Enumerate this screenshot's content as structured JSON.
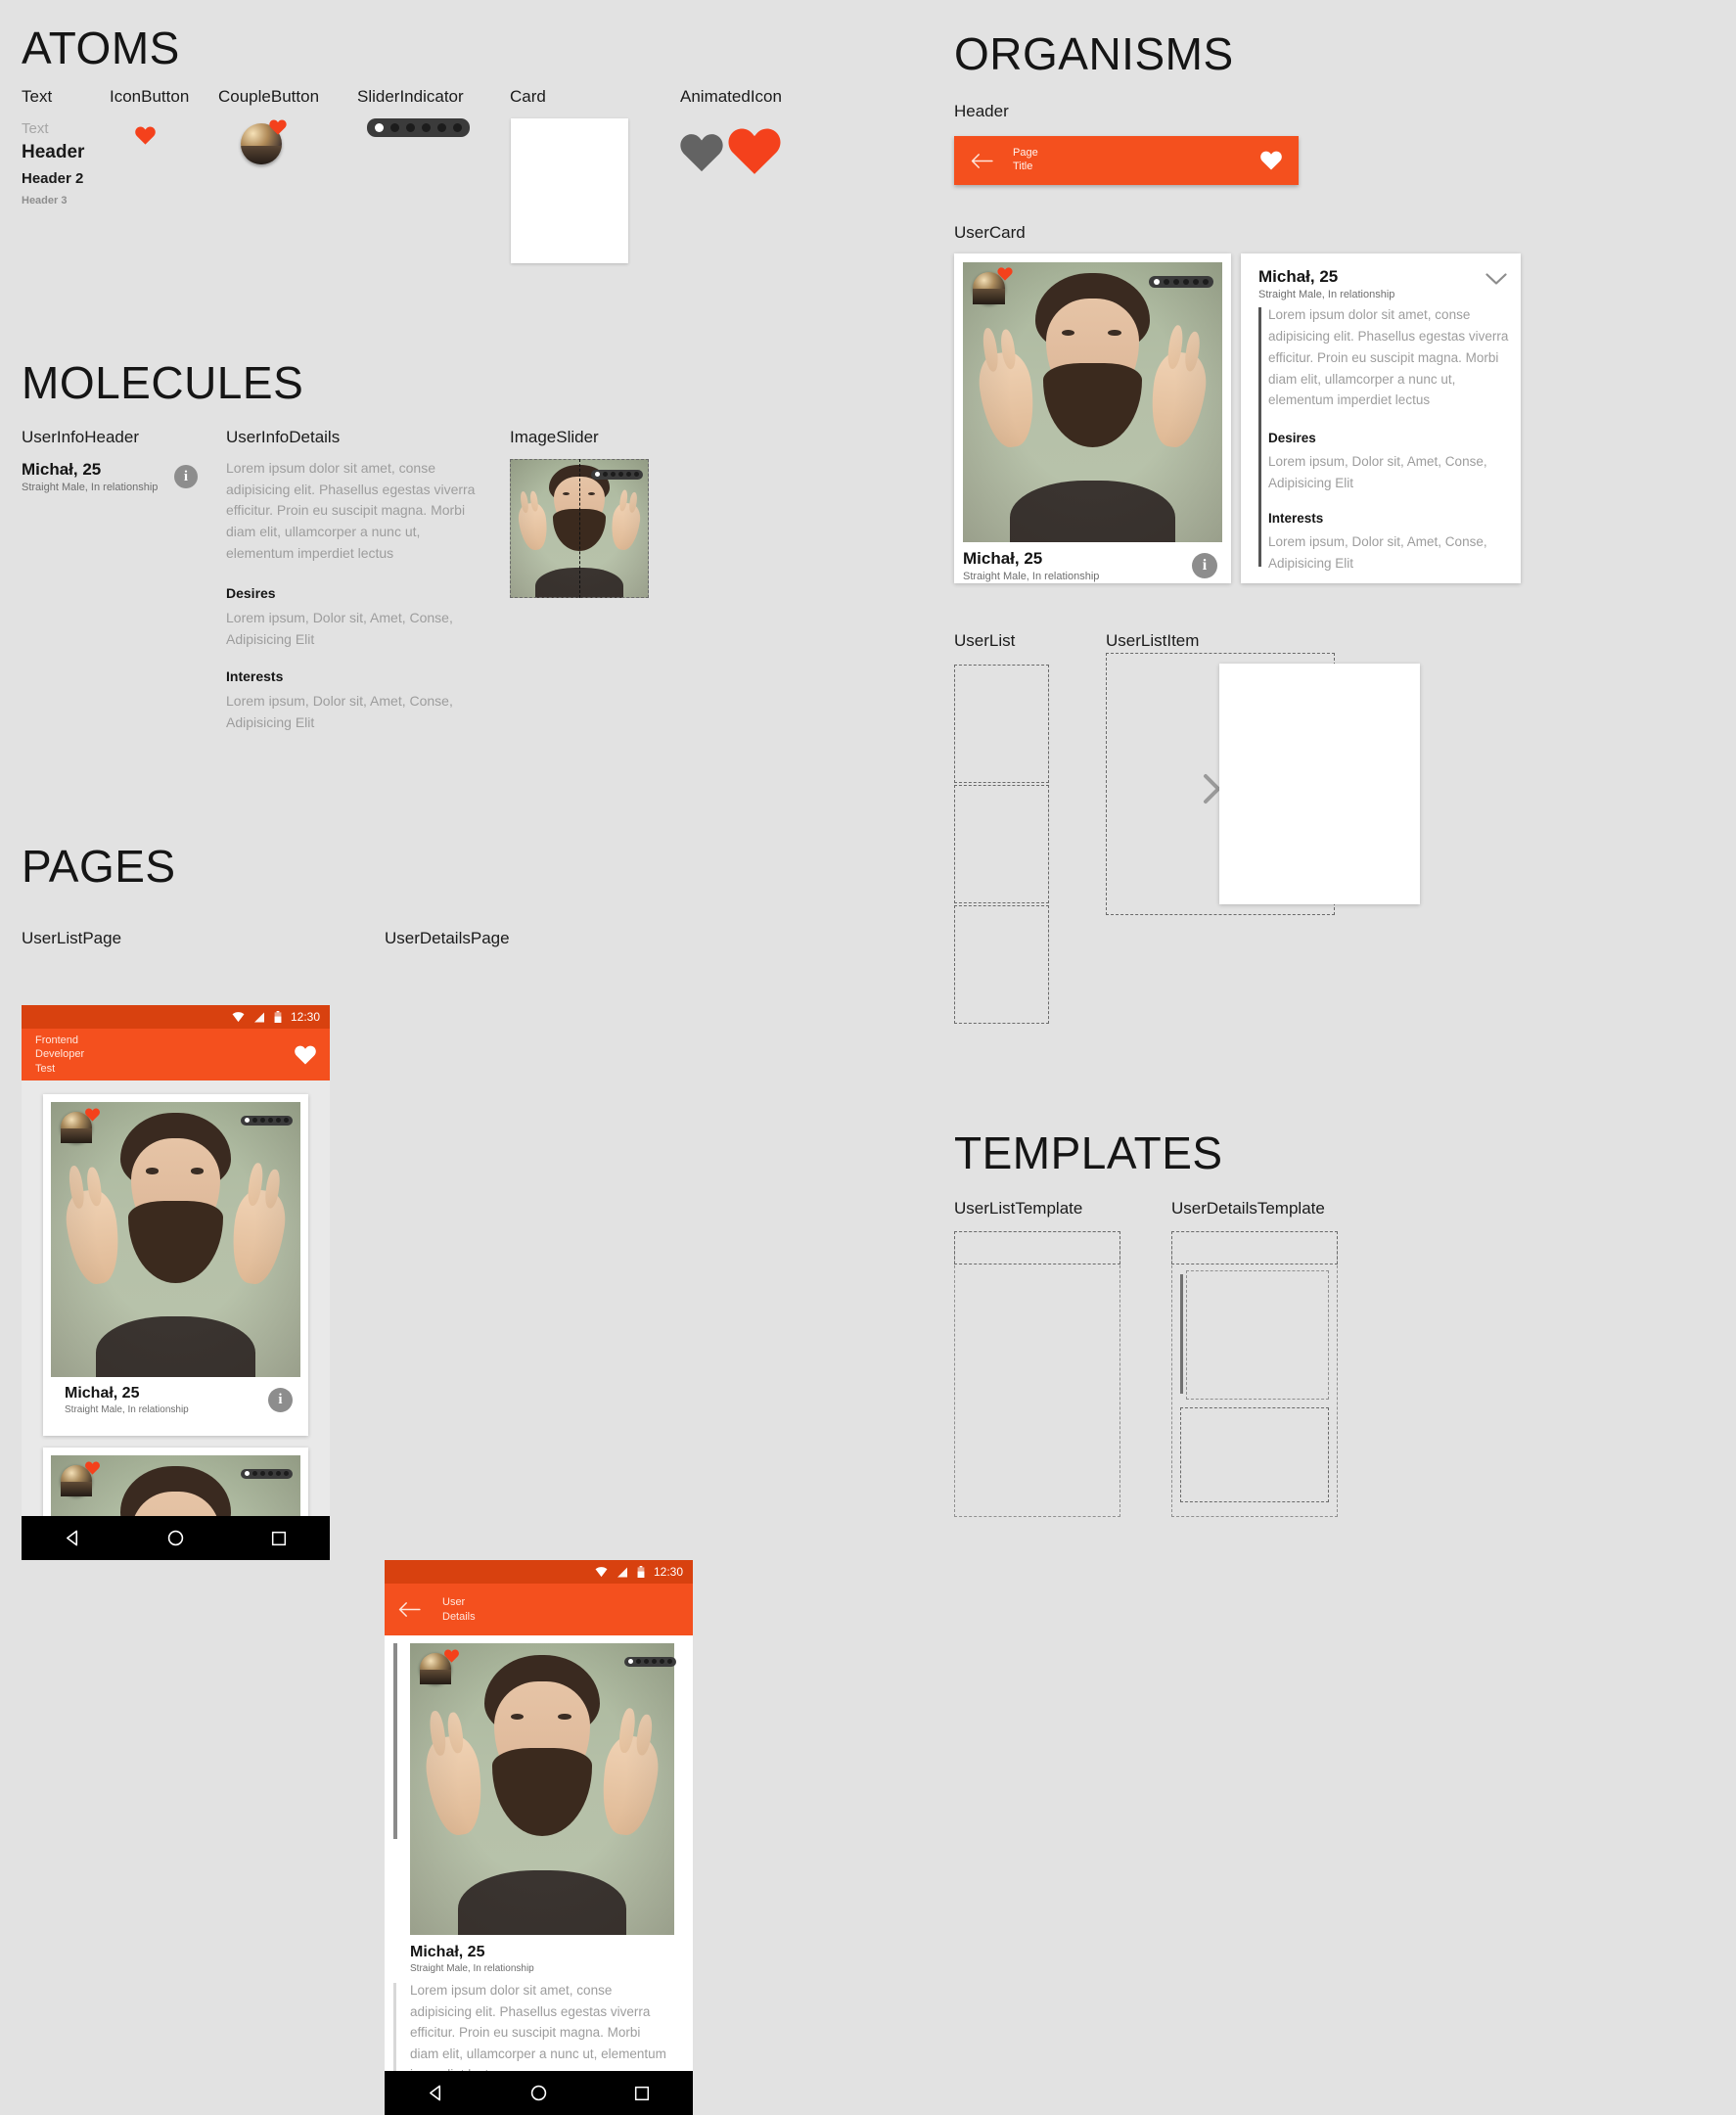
{
  "meta": {
    "bg_color": "#e2e2e2",
    "accent": "#f4501e",
    "accent_dark": "#d8410f",
    "heart_red": "#f4411c",
    "heart_gray": "#616161",
    "muted_text": "#9d9d9d"
  },
  "sections": {
    "atoms": "ATOMS",
    "molecules": "MOLECULES",
    "pages": "PAGES",
    "organisms": "ORGANISMS",
    "templates": "TEMPLATES"
  },
  "atoms": {
    "labels": {
      "text": "Text",
      "icon_button": "IconButton",
      "couple_button": "CoupleButton",
      "slider_indicator": "SliderIndicator",
      "card": "Card",
      "animated_icon": "AnimatedIcon"
    },
    "text_samples": {
      "body": "Text",
      "header": "Header",
      "header2": "Header 2",
      "header3": "Header 3"
    },
    "slider": {
      "total": 6,
      "active_index": 0
    }
  },
  "molecules": {
    "labels": {
      "user_info_header": "UserInfoHeader",
      "user_info_details": "UserInfoDetails",
      "image_slider": "ImageSlider"
    },
    "user": {
      "name": "Michał, 25",
      "subtitle": "Straight Male, In relationship",
      "info_icon_glyph": "i"
    },
    "details": {
      "bio": "Lorem ipsum dolor sit amet, conse adipisicing elit. Phasellus egestas viverra efficitur. Proin eu suscipit magna. Morbi diam elit, ullamcorper a nunc ut, elementum imperdiet lectus",
      "desires_label": "Desires",
      "desires_value": "Lorem ipsum, Dolor sit, Amet, Conse, Adipisicing Elit",
      "interests_label": "Interests",
      "interests_value": "Lorem ipsum, Dolor sit, Amet, Conse, Adipisicing Elit"
    }
  },
  "organisms": {
    "labels": {
      "header": "Header",
      "user_card": "UserCard",
      "user_list": "UserList",
      "user_list_item": "UserListItem"
    },
    "header_bar": {
      "title_line1": "Page",
      "title_line2": "Title",
      "back_icon": "arrow-left-icon",
      "action_icon": "heart-icon"
    },
    "user_card": {
      "name": "Michał, 25",
      "subtitle": "Straight Male, In relationship",
      "bio": "Lorem ipsum dolor sit amet, conse adipisicing elit. Phasellus egestas viverra efficitur. Proin eu suscipit magna. Morbi diam elit, ullamcorper a nunc ut, elementum imperdiet lectus",
      "desires_label": "Desires",
      "desires_value": "Lorem ipsum, Dolor sit, Amet, Conse, Adipisicing Elit",
      "interests_label": "Interests",
      "interests_value": "Lorem ipsum, Dolor sit, Amet, Conse, Adipisicing Elit",
      "info_icon_glyph": "i",
      "expand_icon": "chevron-down-icon",
      "slider": {
        "total": 6,
        "active_index": 0
      }
    }
  },
  "pages": {
    "labels": {
      "user_list_page": "UserListPage",
      "user_details_page": "UserDetailsPage"
    },
    "status_bar": {
      "time": "12:30",
      "icons": [
        "wifi-icon",
        "signal-icon",
        "battery-icon"
      ]
    },
    "user_list_page": {
      "title_line1": "Frontend",
      "title_line2": "Developer",
      "title_line3": "Test",
      "action_icon": "heart-icon",
      "card": {
        "name": "Michał, 25",
        "subtitle": "Straight Male, In relationship",
        "info_icon_glyph": "i",
        "slider": {
          "total": 6,
          "active_index": 0
        }
      }
    },
    "user_details_page": {
      "title_line1": "User",
      "title_line2": "Details",
      "back_icon": "arrow-left-icon",
      "card": {
        "name": "Michał, 25",
        "subtitle": "Straight Male, In relationship",
        "bio": "Lorem ipsum dolor sit amet, conse adipisicing elit. Phasellus egestas viverra efficitur. Proin eu suscipit magna. Morbi diam elit, ullamcorper a nunc ut, elementum imperdiet lectus",
        "slider": {
          "total": 6,
          "active_index": 0
        }
      }
    },
    "nav_bar": {
      "back": "triangle-back-icon",
      "home": "circle-home-icon",
      "recents": "square-recents-icon"
    }
  },
  "templates": {
    "labels": {
      "user_list_template": "UserListTemplate",
      "user_details_template": "UserDetailsTemplate"
    }
  }
}
